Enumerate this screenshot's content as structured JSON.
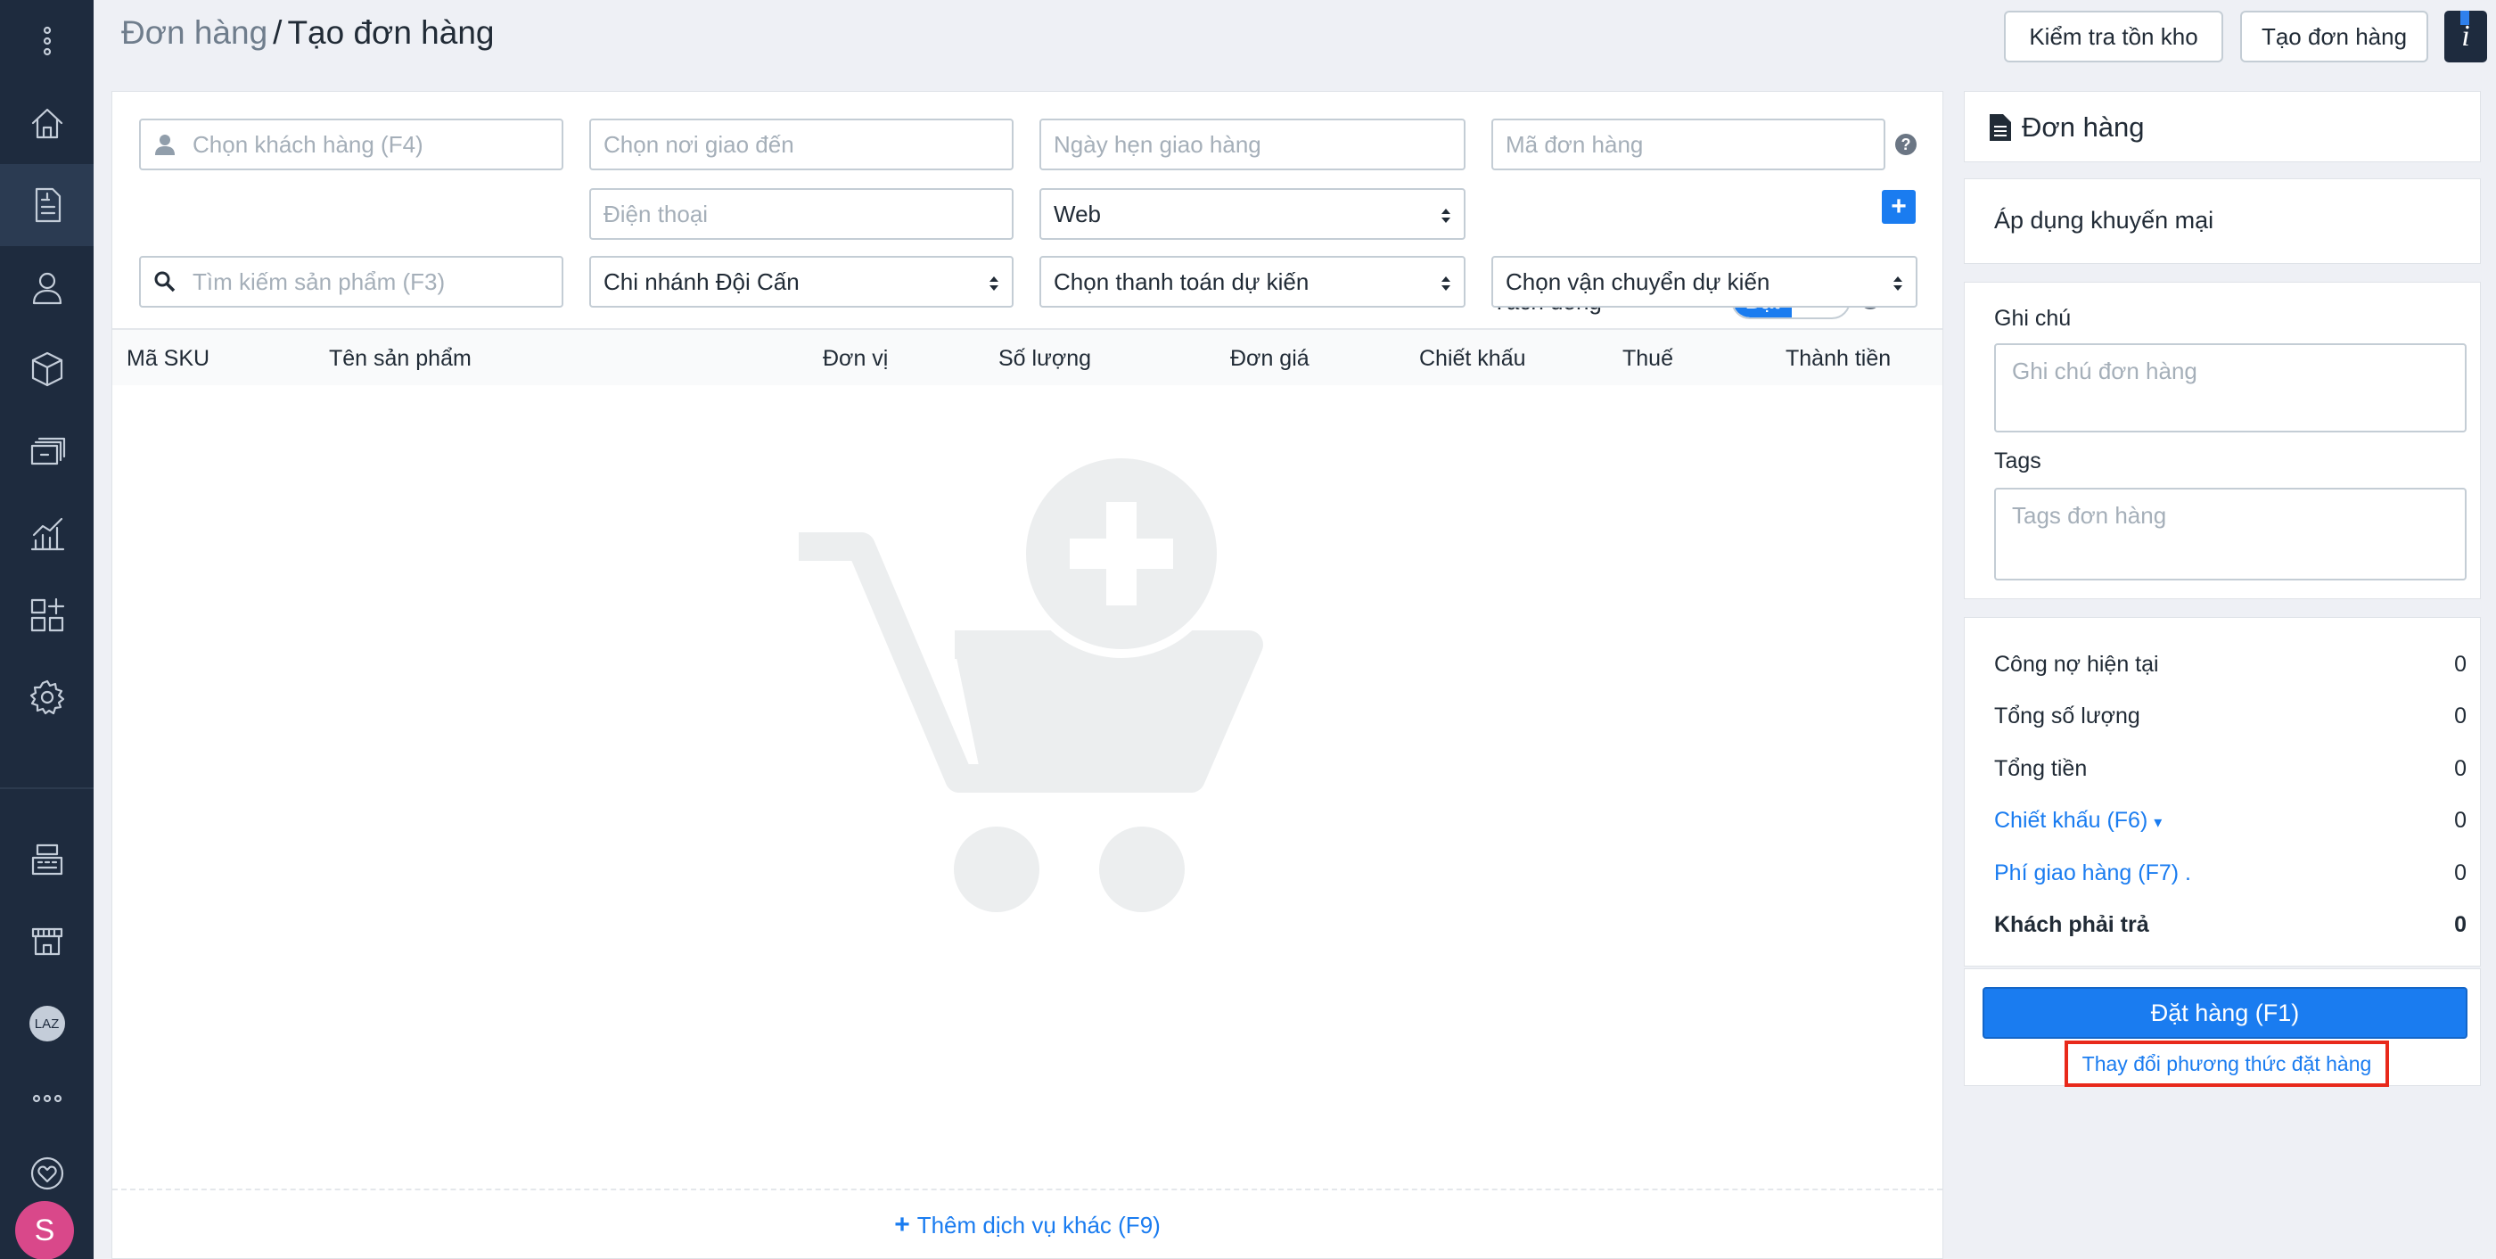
{
  "sidebar": {
    "items": [
      {
        "icon": "menu-dots-icon"
      },
      {
        "icon": "home-icon"
      },
      {
        "icon": "order-document-icon"
      },
      {
        "icon": "customer-icon"
      },
      {
        "icon": "product-box-icon"
      },
      {
        "icon": "cashbook-icon"
      },
      {
        "icon": "report-chart-icon"
      },
      {
        "icon": "apps-icon"
      },
      {
        "icon": "settings-gear-icon"
      },
      {
        "icon": "pos-register-icon"
      },
      {
        "icon": "storefront-icon"
      },
      {
        "icon": "lazada-icon",
        "label": "LAZ"
      },
      {
        "icon": "more-dots-icon"
      },
      {
        "icon": "heart-icon"
      }
    ],
    "avatar_letter": "S"
  },
  "header": {
    "breadcrumb_parent": "Đơn hàng",
    "breadcrumb_sep": "/",
    "breadcrumb_current": "Tạo đơn hàng",
    "check_stock_label": "Kiểm tra tồn kho",
    "create_order_label": "Tạo đơn hàng",
    "info_label": "i"
  },
  "form": {
    "customer_placeholder": "Chọn khách hàng (F4)",
    "delivery_place_placeholder": "Chọn nơi giao đến",
    "delivery_date_placeholder": "Ngày hẹn giao hàng",
    "order_code_placeholder": "Mã đơn hàng",
    "phone_placeholder": "Điện thoại",
    "source_value": "Web",
    "split_line_label": "Tách dòng",
    "split_toggle_on": "Bật",
    "product_search_placeholder": "Tìm kiếm sản phẩm (F3)",
    "branch_value": "Chi nhánh Đội Cấn",
    "payment_value": "Chọn thanh toán dự kiến",
    "shipping_value": "Chọn vận chuyển dự kiến",
    "help_mark": "?",
    "add_mark": "+"
  },
  "table": {
    "headers": [
      "Mã SKU",
      "Tên sản phẩm",
      "Đơn vị",
      "Số lượng",
      "Đơn giá",
      "Chiết khấu",
      "Thuế",
      "Thành tiền"
    ],
    "rows": []
  },
  "add_service": {
    "plus": "+",
    "label": "Thêm dịch vụ khác (F9)"
  },
  "right": {
    "order_card_title": "Đơn hàng",
    "promo_link": "Áp dụng khuyến mại",
    "note_label": "Ghi chú",
    "note_placeholder": "Ghi chú đơn hàng",
    "tags_label": "Tags",
    "tags_placeholder": "Tags đơn hàng",
    "summary": {
      "debt_label": "Công nợ hiện tại",
      "debt_value": "0",
      "qty_label": "Tổng số lượng",
      "qty_value": "0",
      "total_label": "Tổng tiền",
      "total_value": "0",
      "discount_label": "Chiết khấu (F6)",
      "discount_value": "0",
      "ship_label": "Phí giao hàng (F7) .",
      "ship_value": "0",
      "pay_label": "Khách phải trả",
      "pay_value": "0"
    },
    "place_order_label": "Đặt hàng (F1)",
    "change_method_label": "Thay đổi phương thức đặt hàng"
  },
  "colors": {
    "sidebar_bg": "#1e2b3e",
    "accent": "#1a7cf0",
    "highlight_border": "#e8291b"
  }
}
